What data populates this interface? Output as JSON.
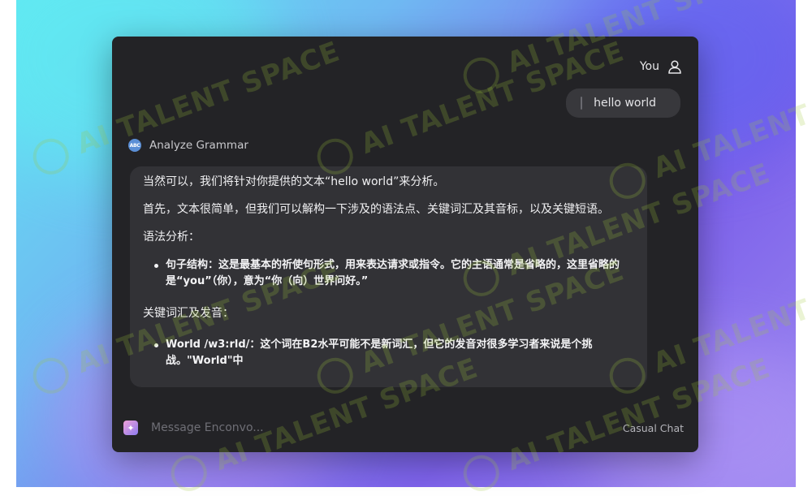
{
  "user": {
    "name": "You",
    "message": "hello world"
  },
  "assistant": {
    "name": "Analyze Grammar",
    "icon_text": "ABC",
    "paragraphs": [
      "当然可以，我们将针对你提供的文本“hello world”来分析。",
      "首先，文本很简单，但我们可以解构一下涉及的语法点、关键词汇及其音标，以及关键短语。",
      "语法分析："
    ],
    "bullets_1": [
      "句子结构：这是最基本的祈使句形式，用来表达请求或指令。它的主语通常是省略的，这里省略的是“you”（你），意为“你（向）世界问好。”"
    ],
    "section_2": "关键词汇及发音：",
    "bullets_2": [
      "World /w3:rld/：这个词在B2水平可能不是新词汇，但它的发音对很多学习者来说是个挑战。\"World\"中"
    ]
  },
  "composer": {
    "placeholder": "Message Enconvo...",
    "mode": "Casual Chat"
  },
  "watermark": {
    "text": "AI TALENT SPACE"
  },
  "colors": {
    "window_bg": "#232326",
    "bubble_bg": "#323236",
    "accent_gradient_start": "#63e3f3",
    "accent_gradient_end": "#7d62ea"
  }
}
